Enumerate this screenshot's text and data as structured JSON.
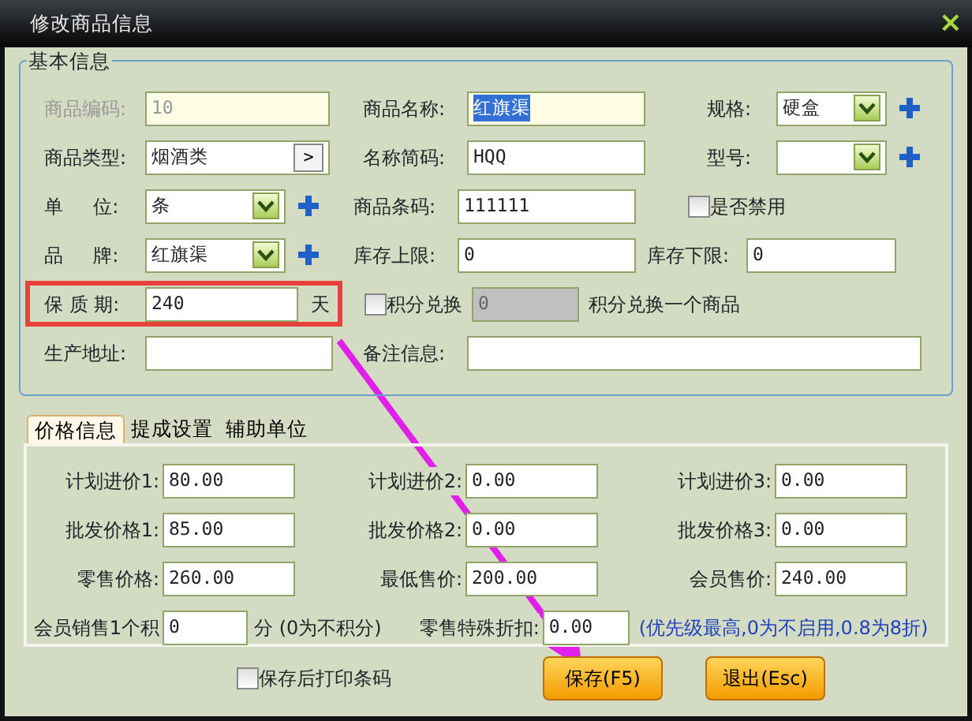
{
  "window": {
    "title": "修改商品信息",
    "close": "×"
  },
  "basic_info": {
    "title": "基本信息",
    "product_code": {
      "label": "商品编码:",
      "value": "10",
      "disabled": true
    },
    "product_name": {
      "label": "商品名称:",
      "value": "红旗渠",
      "text_selected": true
    },
    "spec": {
      "label": "规格:",
      "value": "硬盒"
    },
    "category": {
      "label": "商品类型:",
      "value": "烟酒类",
      "button": ">"
    },
    "short_name": {
      "label": "名称简码:",
      "value": "HQQ"
    },
    "model": {
      "label": "型号:"
    },
    "unit": {
      "label": "单     位:",
      "value": "条"
    },
    "barcode": {
      "label": "商品条码:",
      "value": "111111"
    },
    "disabled_flag": {
      "label": "是否禁用",
      "checked": false
    },
    "brand": {
      "label": "品     牌:",
      "value": "红旗渠"
    },
    "stock_max": {
      "label": "库存上限:",
      "value": "0"
    },
    "stock_min": {
      "label": "库存下限:",
      "value": "0"
    },
    "shelf_life": {
      "label": "保 质 期:",
      "value": "240",
      "unit": "天",
      "highlighted": true
    },
    "points_exchange": {
      "label": "积分兑换",
      "checked": false,
      "value": "0",
      "note": "积分兑换一个商品"
    },
    "origin": {
      "label": "生产地址:"
    },
    "remarks": {
      "label": "备注信息:"
    }
  },
  "tabs": [
    {
      "label": "价格信息",
      "selected": true
    },
    {
      "label": "提成设置",
      "selected": false
    },
    {
      "label": "辅助单位",
      "selected": false
    }
  ],
  "prices": [
    [
      {
        "label": "计划进价1:",
        "value": "80.00"
      },
      {
        "label": "计划进价2:",
        "value": "0.00"
      },
      {
        "label": "计划进价3:",
        "value": "0.00"
      }
    ],
    [
      {
        "label": "批发价格1:",
        "value": "85.00"
      },
      {
        "label": "批发价格2:",
        "value": "0.00"
      },
      {
        "label": "批发价格3:",
        "value": "0.00"
      }
    ],
    [
      {
        "label": "零售价格:",
        "value": "260.00"
      },
      {
        "label": "最低售价:",
        "value": "200.00"
      },
      {
        "label": "会员售价:",
        "value": "240.00"
      }
    ]
  ],
  "points": {
    "label": "会员销售1个积",
    "value": "0",
    "note": "分 (0为不积分)"
  },
  "discount": {
    "label": "零售特殊折扣:",
    "value": "0.00",
    "note": "(优先级最高,0为不启用,0.8为8折)"
  },
  "print_after_save": {
    "label": "保存后打印条码",
    "checked": false
  },
  "buttons": [
    "保存(F5)",
    "退出(Esc)"
  ],
  "annotation": {
    "arrow": true
  }
}
